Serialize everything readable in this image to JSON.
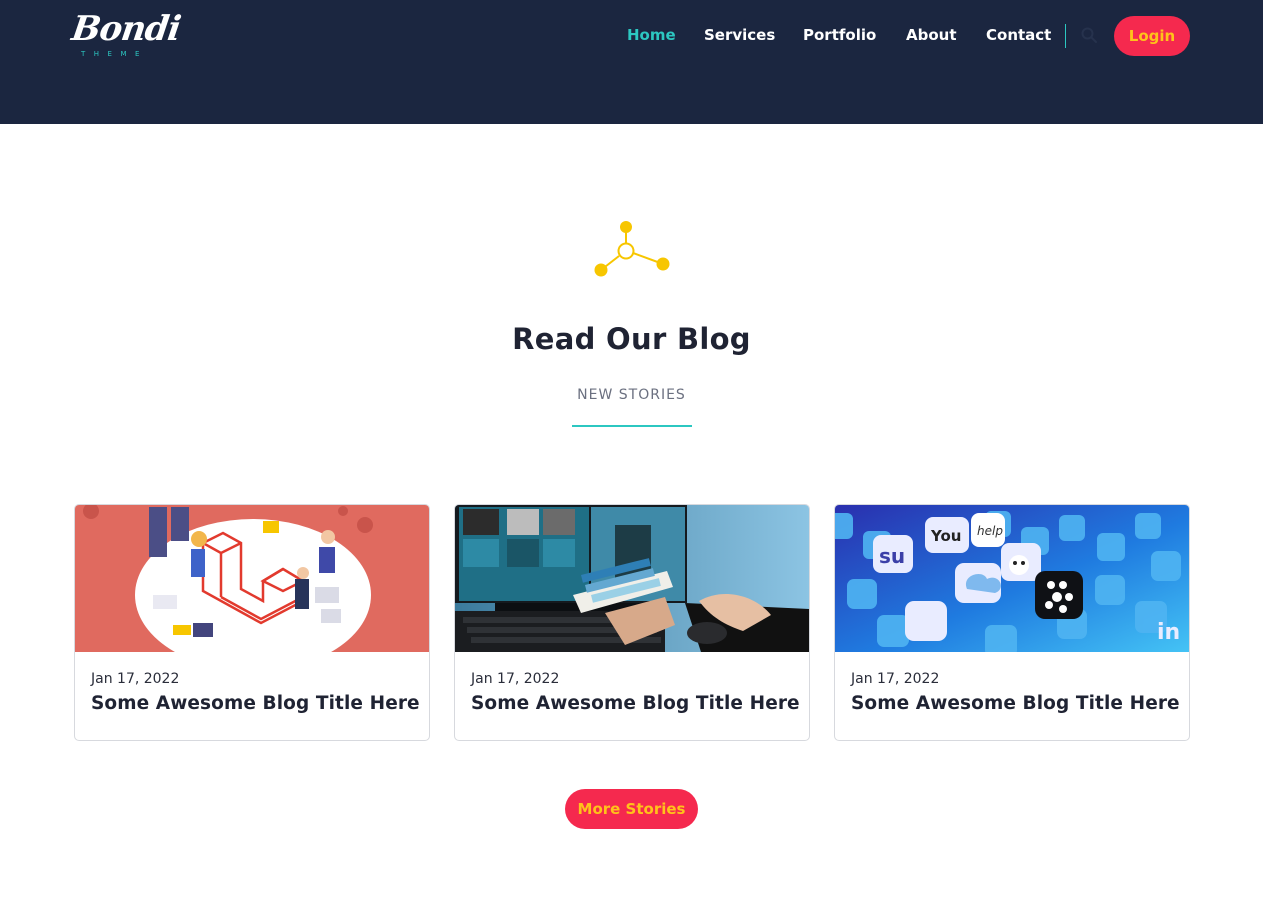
{
  "brand": {
    "name": "Bondi",
    "tagline": "THEME"
  },
  "nav": {
    "items": [
      {
        "label": "Home",
        "active": true
      },
      {
        "label": "Services",
        "active": false
      },
      {
        "label": "Portfolio",
        "active": false
      },
      {
        "label": "About",
        "active": false
      },
      {
        "label": "Contact",
        "active": false
      }
    ],
    "search_icon": "search-icon",
    "login_label": "Login"
  },
  "section": {
    "icon": "share-nodes-icon",
    "title": "Read Our Blog",
    "subtitle": "NEW STORIES"
  },
  "posts": [
    {
      "date": "Jan 17, 2022",
      "title": "Some Awesome Blog Title Here",
      "image": "laravel-isometric-illustration"
    },
    {
      "date": "Jan 17, 2022",
      "title": "Some Awesome Blog Title Here",
      "image": "designer-color-swatches-photo"
    },
    {
      "date": "Jan 17, 2022",
      "title": "Some Awesome Blog Title Here",
      "image": "social-media-app-icons-photo"
    }
  ],
  "more_label": "More Stories",
  "colors": {
    "header_bg": "#1b2640",
    "accent_teal": "#2cc7c1",
    "button_red": "#f5294e",
    "button_text_yellow": "#ffc21a",
    "icon_yellow": "#f7c600"
  }
}
